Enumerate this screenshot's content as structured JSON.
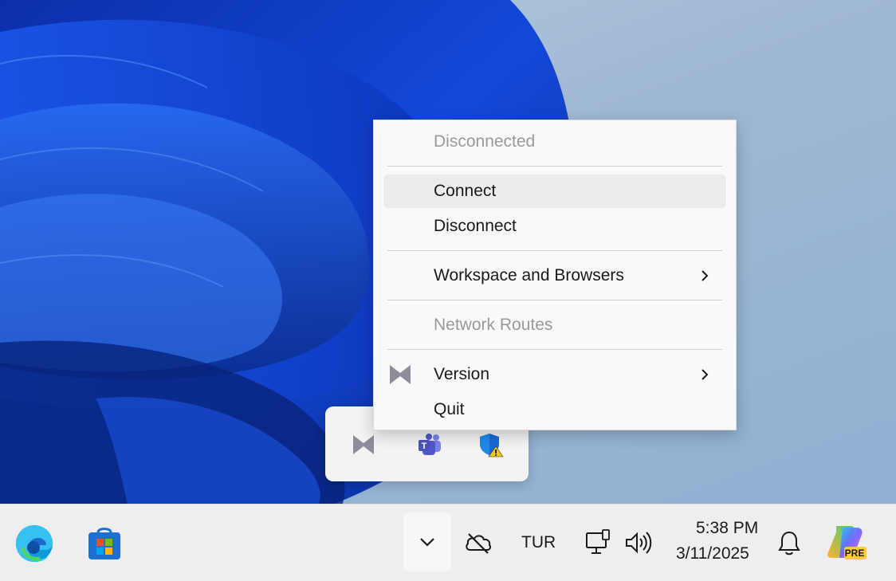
{
  "context_menu": {
    "status": "Disconnected",
    "connect": "Connect",
    "disconnect": "Disconnect",
    "workspace": "Workspace and Browsers",
    "network_routes": "Network Routes",
    "version": "Version",
    "quit": "Quit"
  },
  "tray_flyout": {
    "icons": [
      "vpn-app-icon",
      "teams-icon",
      "defender-warning-icon"
    ]
  },
  "taskbar": {
    "language": "TUR",
    "time": "5:38 PM",
    "date": "3/11/2025",
    "copilot_badge": "PRE",
    "icons": [
      "edge-icon",
      "store-icon",
      "chevron-up-icon",
      "onedrive-offline-icon",
      "network-icon",
      "volume-icon",
      "notification-bell-icon",
      "copilot-icon"
    ]
  },
  "colors": {
    "accent": "#0a3fd4",
    "menu_bg": "#f9f9f9",
    "taskbar_bg": "#eeeeee",
    "disabled_text": "#9a9a9a"
  }
}
